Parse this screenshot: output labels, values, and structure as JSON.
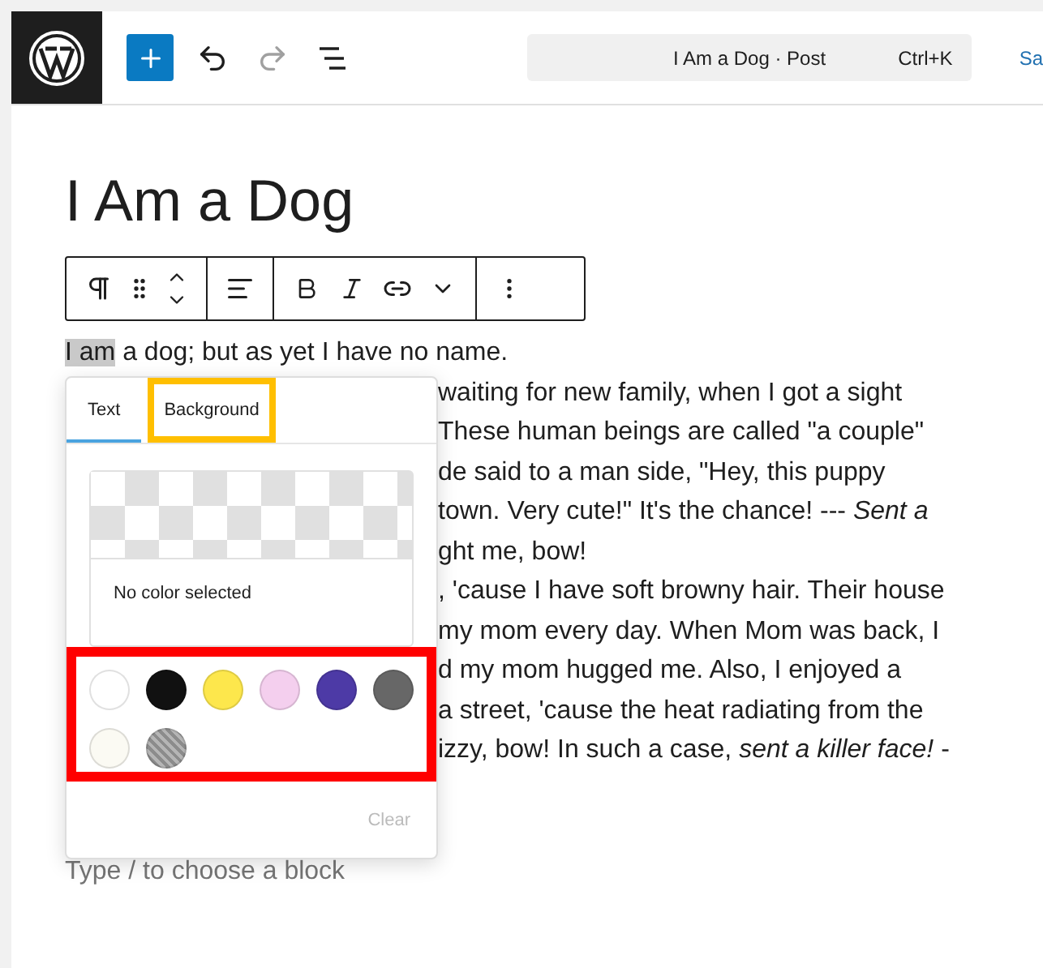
{
  "header": {
    "add_block": {
      "selected": true
    },
    "undo": {
      "disabled": false
    },
    "redo": {
      "disabled": true
    },
    "command_bar": {
      "title": "I Am a Dog · Post",
      "shortcut": "Ctrl+K"
    },
    "save": "Sa"
  },
  "post": {
    "title": "I Am a Dog",
    "first_line": {
      "highlighted": "I am",
      "rest": " a dog; but as yet I have no name."
    },
    "visible_lines": [
      "waiting for new family, when I got a sight",
      "These human beings are called \"a couple\"",
      "de said to a man side, \"Hey, this puppy",
      "town. Very cute!\" It's the chance! --- *Sent a*",
      "ght me, bow!",
      ", 'cause I have soft browny hair. Their house",
      "my mom every day. When Mom was back, I",
      "d my mom hugged me. Also, I enjoyed a",
      "a street, 'cause the heat radiating from the",
      "izzy, bow! In such a case, *sent a killer face!* -"
    ],
    "block_placeholder": "Type / to choose a block"
  },
  "color_popover": {
    "tabs": [
      {
        "label": "Text",
        "selected": true
      },
      {
        "label": "Background",
        "selected": false,
        "annotated": true
      }
    ],
    "current": "No color selected",
    "swatches": [
      {
        "color": "#ffffff",
        "kind": "solid"
      },
      {
        "color": "#111111",
        "kind": "solid"
      },
      {
        "color": "#fde74c",
        "kind": "solid"
      },
      {
        "color": "#f4cfee",
        "kind": "solid"
      },
      {
        "color": "#4d3aa6",
        "kind": "solid"
      },
      {
        "color": "#676767",
        "kind": "solid"
      },
      {
        "color": "#fbfaf3",
        "kind": "solid"
      },
      {
        "color": "#8c8c8c",
        "kind": "pattern"
      }
    ],
    "swatches_annotated": true,
    "clear": {
      "label": "Clear",
      "disabled": true
    }
  }
}
